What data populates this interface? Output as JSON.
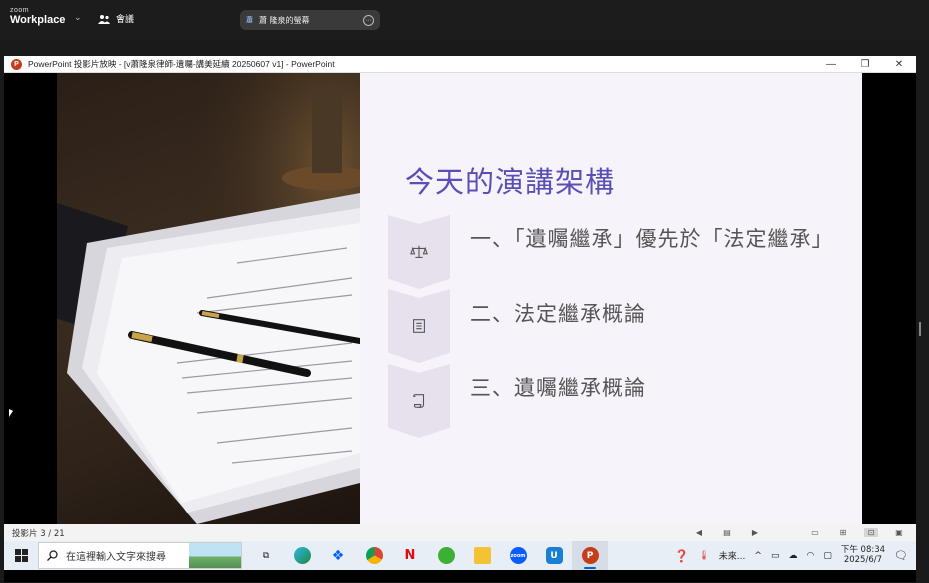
{
  "zoom": {
    "logo_top": "zoom",
    "logo_bottom": "Workplace",
    "meeting_label": "會議",
    "share_label": "蕭 隆泉的螢幕",
    "share_avatar": "蕭"
  },
  "window": {
    "title": "PowerPoint 投影片放映 - [v蕭隆泉律師-遺囑-講美延續 20250607 v1] - PowerPoint",
    "controls": [
      "—",
      "❐",
      "✕"
    ]
  },
  "slide": {
    "title": "今天的演講架構",
    "items": [
      {
        "text": "一、「遺囑繼承」優先於「法定繼承」",
        "icon": "scales-icon"
      },
      {
        "text": "二、法定繼承概論",
        "icon": "book-icon"
      },
      {
        "text": "三、遺囑繼承概論",
        "icon": "scroll-icon"
      }
    ]
  },
  "statusbar": {
    "slide_count": "投影片 3 / 21"
  },
  "taskbar": {
    "search_placeholder": "在這裡輸入文字來搜尋",
    "weather": "未來...",
    "time": "下午 08:34",
    "date": "2025/6/7"
  },
  "colors": {
    "title_color": "#5a4fb4",
    "chevron": "#e6e1ec",
    "slide_bg": "#f6f3fa",
    "powerpoint": "#c43e1c"
  }
}
